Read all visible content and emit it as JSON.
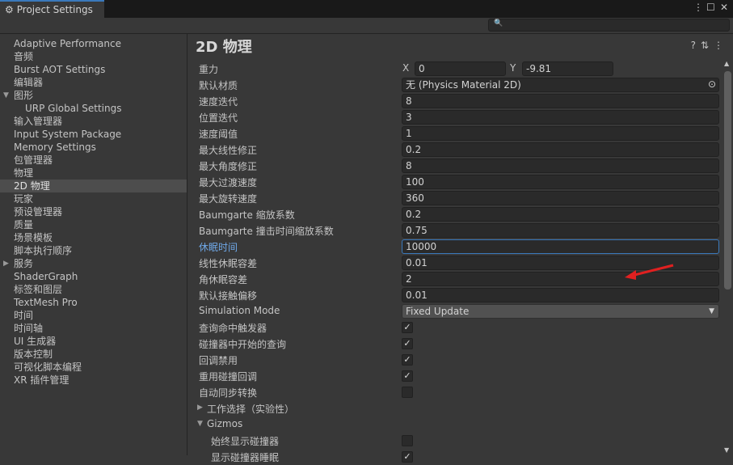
{
  "window": {
    "title": "Project Settings",
    "controls": [
      "kebab-menu-icon",
      "maximize-icon",
      "close-icon"
    ]
  },
  "search": {
    "placeholder": ""
  },
  "sidebar": {
    "items": [
      {
        "label": "Adaptive Performance"
      },
      {
        "label": "音频"
      },
      {
        "label": "Burst AOT Settings"
      },
      {
        "label": "编辑器"
      },
      {
        "label": "图形",
        "expanded": true
      },
      {
        "label": "URP Global Settings",
        "sub": true
      },
      {
        "label": "输入管理器"
      },
      {
        "label": "Input System Package"
      },
      {
        "label": "Memory Settings"
      },
      {
        "label": "包管理器"
      },
      {
        "label": "物理"
      },
      {
        "label": "2D 物理",
        "selected": true
      },
      {
        "label": "玩家"
      },
      {
        "label": "预设管理器"
      },
      {
        "label": "质量"
      },
      {
        "label": "场景模板"
      },
      {
        "label": "脚本执行顺序"
      },
      {
        "label": "服务",
        "collapsed": true
      },
      {
        "label": "ShaderGraph"
      },
      {
        "label": "标签和图层"
      },
      {
        "label": "TextMesh Pro"
      },
      {
        "label": "时间"
      },
      {
        "label": "时间轴"
      },
      {
        "label": "UI 生成器"
      },
      {
        "label": "版本控制"
      },
      {
        "label": "可视化脚本编程"
      },
      {
        "label": "XR 插件管理"
      }
    ]
  },
  "main": {
    "title": "2D 物理",
    "gravity": {
      "label": "重力",
      "x_label": "X",
      "x": "0",
      "y_label": "Y",
      "y": "-9.81"
    },
    "material": {
      "label": "默认材质",
      "value": "无 (Physics Material 2D)"
    },
    "fields": [
      {
        "label": "速度迭代",
        "value": "8"
      },
      {
        "label": "位置迭代",
        "value": "3"
      },
      {
        "label": "速度阈值",
        "value": "1"
      },
      {
        "label": "最大线性修正",
        "value": "0.2"
      },
      {
        "label": "最大角度修正",
        "value": "8"
      },
      {
        "label": "最大过渡速度",
        "value": "100"
      },
      {
        "label": "最大旋转速度",
        "value": "360"
      },
      {
        "label": "Baumgarte 缩放系数",
        "value": "0.2"
      },
      {
        "label": "Baumgarte 撞击时间缩放系数",
        "value": "0.75"
      },
      {
        "label": "休眠时间",
        "value": "10000",
        "active": true
      },
      {
        "label": "线性休眠容差",
        "value": "0.01"
      },
      {
        "label": "角休眠容差",
        "value": "2"
      },
      {
        "label": "默认接触偏移",
        "value": "0.01"
      }
    ],
    "simulation_mode": {
      "label": "Simulation Mode",
      "value": "Fixed Update"
    },
    "checks": [
      {
        "label": "查询命中触发器",
        "checked": true
      },
      {
        "label": "碰撞器中开始的查询",
        "checked": true
      },
      {
        "label": "回调禁用",
        "checked": true
      },
      {
        "label": "重用碰撞回调",
        "checked": true
      },
      {
        "label": "自动同步转换",
        "checked": false
      }
    ],
    "job_options": {
      "label": "工作选择（实验性）"
    },
    "gizmos": {
      "label": "Gizmos",
      "items": [
        {
          "label": "始终显示碰撞器",
          "checked": false
        },
        {
          "label": "显示碰撞器睡眠",
          "checked": true
        }
      ]
    }
  },
  "annotation_color": "#e02020"
}
